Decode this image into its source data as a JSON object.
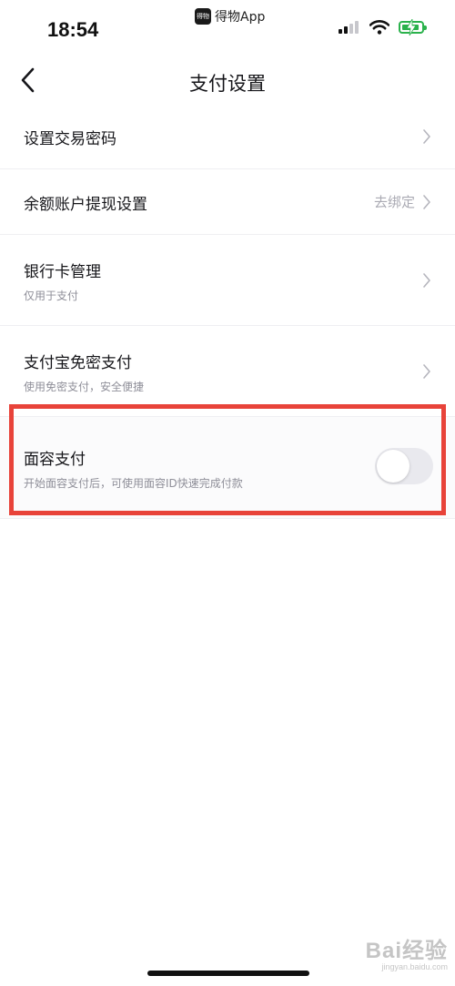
{
  "status_bar": {
    "time": "18:54",
    "app_name": "得物App",
    "app_icon_text": "得物",
    "battery_color": "#2bb24c"
  },
  "nav": {
    "title": "支付设置"
  },
  "settings": {
    "trade_password": {
      "title": "设置交易密码"
    },
    "withdraw": {
      "title": "余额账户提现设置",
      "right_text": "去绑定"
    },
    "bank_card": {
      "title": "银行卡管理",
      "subtitle": "仅用于支付"
    },
    "alipay": {
      "title": "支付宝免密支付",
      "subtitle": "使用免密支付，安全便捷"
    },
    "face_pay": {
      "title": "面容支付",
      "subtitle": "开始面容支付后，可使用面容ID快速完成付款",
      "enabled": false
    }
  },
  "highlight_color": "#e8433a",
  "watermark": {
    "main": "Bai经验",
    "sub": "jingyan.baidu.com"
  }
}
